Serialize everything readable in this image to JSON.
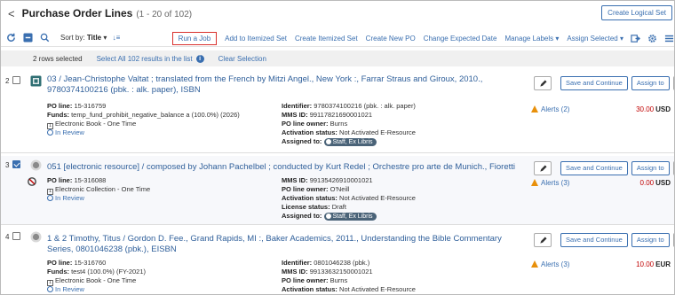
{
  "header": {
    "title": "Purchase Order Lines",
    "count": "(1 - 20 of 102)",
    "create_logical_set": "Create Logical Set"
  },
  "toolbar": {
    "sort_prefix": "Sort by:",
    "sort_value": "Title",
    "actions": [
      "Run a Job",
      "Add to Itemized Set",
      "Create Itemized Set",
      "Create New PO",
      "Change Expected Date",
      "Manage Labels ▾",
      "Assign Selected ▾"
    ]
  },
  "selection": {
    "count_text": "2 rows selected",
    "select_all": "Select All 102 results in the list",
    "clear": "Clear Selection"
  },
  "common": {
    "save_continue": "Save and Continue",
    "assign_to": "Assign to",
    "more": "···"
  },
  "rows": [
    {
      "num": "2",
      "checked": false,
      "title": "03 / Jean-Christophe Valtat ; translated from the French by Mitzi Angel., New York :, Farrar Straus and Giroux, 2010., 9780374100216 (pbk. : alk. paper), ISBN",
      "po_line_label": "PO line:",
      "po_line": "15-316759",
      "funds_label": "Funds:",
      "funds": "temp_fund_prohibit_negative_balance a (100.0%) (2026)",
      "type_num": "1",
      "type": "Electronic Book - One Time",
      "status": "In Review",
      "identifier_label": "Identifier:",
      "identifier": "9780374100216 (pbk. : alk. paper)",
      "mms_label": "MMS ID:",
      "mms": "99117821690001021",
      "owner_label": "PO line owner:",
      "owner": "Burns",
      "activation_label": "Activation status:",
      "activation": "Not Activated E-Resource",
      "assigned_label": "Assigned to:",
      "assigned": "Staff, Ex Libris",
      "alerts": "Alerts (2)",
      "amount": "30.00",
      "currency": "USD"
    },
    {
      "num": "3",
      "checked": true,
      "title": "051 [electronic resource] / composed by Johann Pachelbel ; conducted by Kurt Redel ; Orchestre pro arte de Munich., Fioretti",
      "po_line_label": "PO line:",
      "po_line": "15-316088",
      "type_num": "1",
      "type": "Electronic Collection - One Time",
      "status": "In Review",
      "mms_label": "MMS ID:",
      "mms": "99135426910001021",
      "owner_label": "PO line owner:",
      "owner": "O'Neill",
      "activation_label": "Activation status:",
      "activation": "Not Activated E-Resource",
      "license_label": "License status:",
      "license": "Draft",
      "assigned_label": "Assigned to:",
      "assigned": "Staff, Ex Libris",
      "alerts": "Alerts (3)",
      "amount": "0.00",
      "currency": "USD"
    },
    {
      "num": "4",
      "checked": false,
      "title": "1 & 2 Timothy, Titus / Gordon D. Fee., Grand Rapids, MI :, Baker Academics, 2011., Understanding the Bible Commentary Series, 0801046238 (pbk.), EISBN",
      "po_line_label": "PO line:",
      "po_line": "15-316760",
      "funds_label": "Funds:",
      "funds": "test4 (100.0%) (FY-2021)",
      "type_num": "1",
      "type": "Electronic Book - One Time",
      "status": "In Review",
      "identifier_label": "Identifier:",
      "identifier": "0801046238 (pbk.)",
      "mms_label": "MMS ID:",
      "mms": "99133632150001021",
      "owner_label": "PO line owner:",
      "owner": "Burns",
      "activation_label": "Activation status:",
      "activation": "Not Activated E-Resource",
      "alerts": "Alerts (3)",
      "amount": "10.00",
      "currency": "EUR"
    }
  ],
  "colors": {
    "link": "#3a6fb0",
    "highlight_border": "#d9302c",
    "price": "#c00000",
    "warning": "#e8900b",
    "chip": "#4a6378"
  }
}
